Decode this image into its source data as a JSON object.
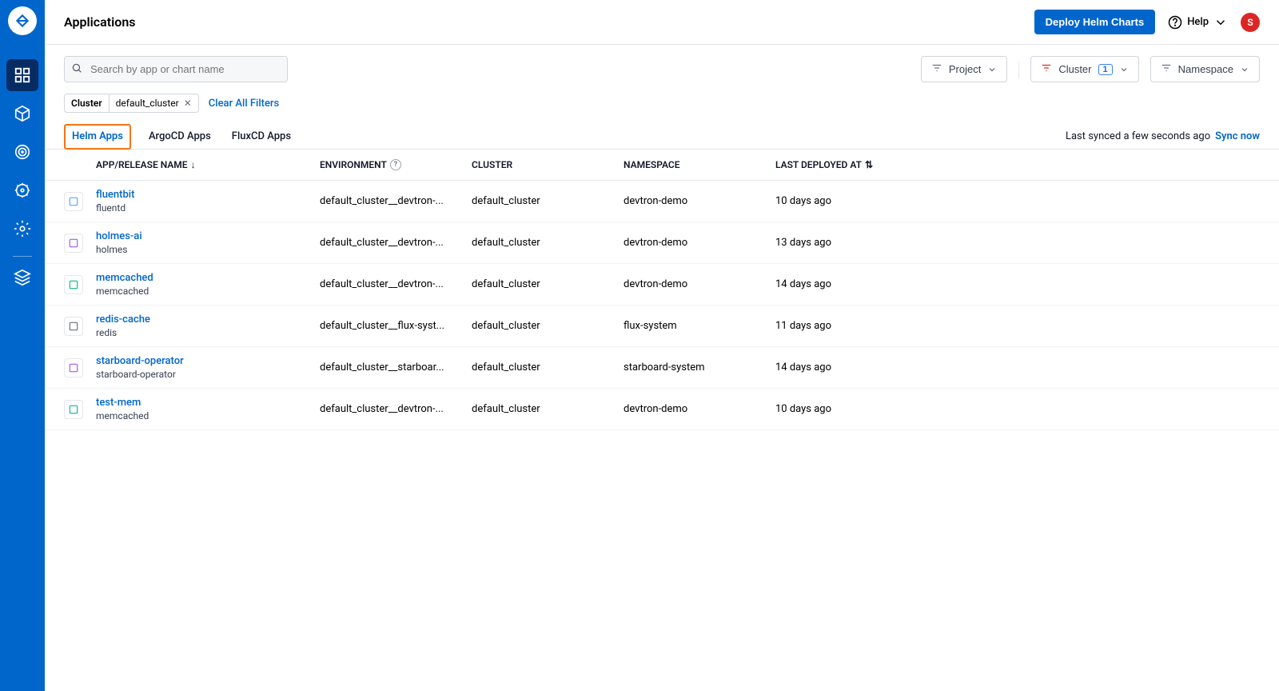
{
  "header": {
    "title": "Applications",
    "deploy_btn": "Deploy Helm Charts",
    "help": "Help",
    "avatar": "S"
  },
  "search": {
    "placeholder": "Search by app or chart name"
  },
  "filters": {
    "project": "Project",
    "cluster": "Cluster",
    "cluster_count": "1",
    "namespace": "Namespace"
  },
  "chip": {
    "key": "Cluster",
    "value": "default_cluster"
  },
  "clear_filters": "Clear All Filters",
  "tabs": [
    "Helm Apps",
    "ArgoCD Apps",
    "FluxCD Apps"
  ],
  "sync": {
    "text": "Last synced a few seconds ago",
    "link": "Sync now"
  },
  "columns": {
    "name": "APP/RELEASE NAME",
    "env": "ENVIRONMENT",
    "cluster": "CLUSTER",
    "ns": "NAMESPACE",
    "deploy": "LAST DEPLOYED AT"
  },
  "rows": [
    {
      "name": "fluentbit",
      "sub": "fluentd",
      "env": "default_cluster__devtron-...",
      "cluster": "default_cluster",
      "ns": "devtron-demo",
      "deploy": "10 days ago",
      "icon_color": "#60a5fa"
    },
    {
      "name": "holmes-ai",
      "sub": "holmes",
      "env": "default_cluster__devtron-...",
      "cluster": "default_cluster",
      "ns": "devtron-demo",
      "deploy": "13 days ago",
      "icon_color": "#a855f7"
    },
    {
      "name": "memcached",
      "sub": "memcached",
      "env": "default_cluster__devtron-...",
      "cluster": "default_cluster",
      "ns": "devtron-demo",
      "deploy": "14 days ago",
      "icon_color": "#10b981"
    },
    {
      "name": "redis-cache",
      "sub": "redis",
      "env": "default_cluster__flux-syst...",
      "cluster": "default_cluster",
      "ns": "flux-system",
      "deploy": "11 days ago",
      "icon_color": "#6b7280"
    },
    {
      "name": "starboard-operator",
      "sub": "starboard-operator",
      "env": "default_cluster__starboar...",
      "cluster": "default_cluster",
      "ns": "starboard-system",
      "deploy": "14 days ago",
      "icon_color": "#a855f7"
    },
    {
      "name": "test-mem",
      "sub": "memcached",
      "env": "default_cluster__devtron-...",
      "cluster": "default_cluster",
      "ns": "devtron-demo",
      "deploy": "10 days ago",
      "icon_color": "#10b981"
    }
  ]
}
